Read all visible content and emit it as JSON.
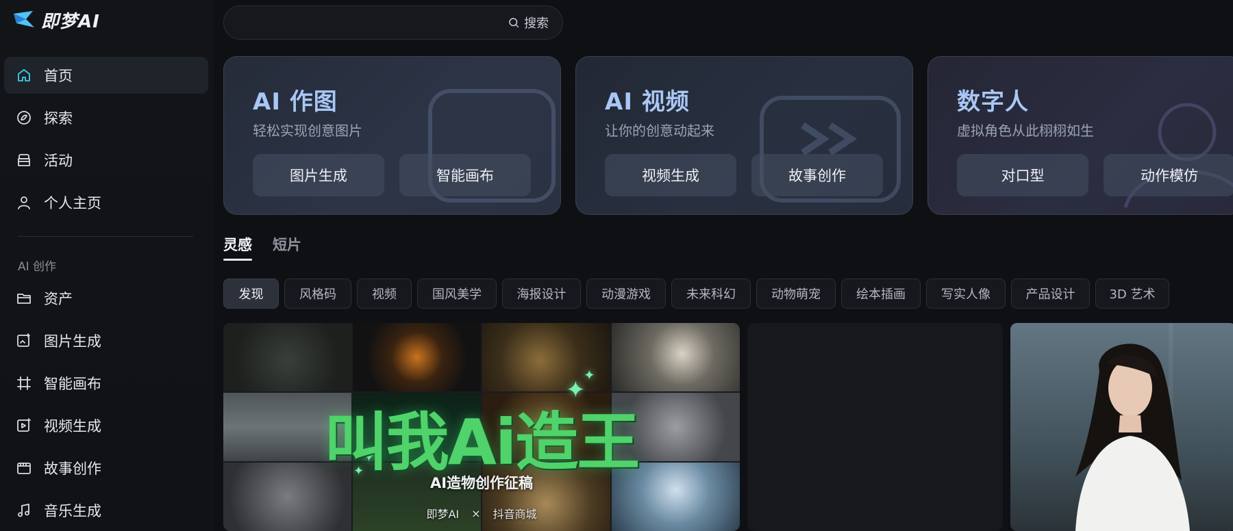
{
  "brand": {
    "name": "即梦AI"
  },
  "search": {
    "button_label": "搜索"
  },
  "nav": {
    "main": [
      {
        "label": "首页",
        "icon": "home-icon",
        "active": true
      },
      {
        "label": "探索",
        "icon": "explore-icon"
      },
      {
        "label": "活动",
        "icon": "event-icon"
      },
      {
        "label": "个人主页",
        "icon": "user-icon"
      }
    ],
    "section_label": "AI 创作",
    "creation": [
      {
        "label": "资产",
        "icon": "folder-icon"
      },
      {
        "label": "图片生成",
        "icon": "image-gen-icon"
      },
      {
        "label": "智能画布",
        "icon": "canvas-icon"
      },
      {
        "label": "视频生成",
        "icon": "video-gen-icon"
      },
      {
        "label": "故事创作",
        "icon": "story-icon"
      },
      {
        "label": "音乐生成",
        "icon": "music-icon"
      }
    ]
  },
  "cards": [
    {
      "title": "AI 作图",
      "subtitle": "轻松实现创意图片",
      "buttons": [
        "图片生成",
        "智能画布"
      ]
    },
    {
      "title": "AI 视频",
      "subtitle": "让你的创意动起来",
      "buttons": [
        "视频生成",
        "故事创作"
      ]
    },
    {
      "title": "数字人",
      "subtitle": "虚拟角色从此栩栩如生",
      "buttons": [
        "对口型",
        "动作模仿"
      ]
    }
  ],
  "tabs": [
    {
      "label": "灵感",
      "active": true
    },
    {
      "label": "短片",
      "active": false
    }
  ],
  "chips": [
    "发现",
    "风格码",
    "视频",
    "国风美学",
    "海报设计",
    "动漫游戏",
    "未来科幻",
    "动物萌宠",
    "绘本插画",
    "写实人像",
    "产品设计",
    "3D 艺术"
  ],
  "active_chip": "发现",
  "promo": {
    "title": "叫我Ai造王",
    "subtitle": "AI造物创作征稿",
    "brand_left": "即梦AI",
    "separator": "×",
    "brand_right": "抖音商城"
  },
  "colors": {
    "accent": "#3fd0e8",
    "promo_green": "#4fd36a",
    "card_title": "#a9c7f5"
  }
}
